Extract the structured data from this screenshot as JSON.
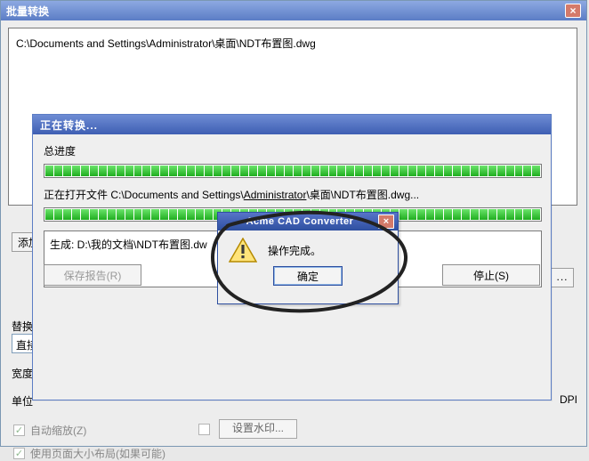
{
  "bg_window": {
    "title": "批量转换",
    "file_list_item": "C:\\Documents and Settings\\Administrator\\桌面\\NDT布置图.dwg",
    "add_file_button": "添加",
    "browse_button": "...",
    "replace_rule_label": "替换规",
    "direct_replace_option": "直接替",
    "width_label": "宽度",
    "unit_label": "单位",
    "dpi_label": "DPI",
    "auto_scale_checkbox": "自动缩放(Z)",
    "set_watermark_button": "设置水印...",
    "use_page_layout_checkbox": "使用页面大小布局(如果可能)"
  },
  "progress_dialog": {
    "title": "正在转换...",
    "overall_label": "总进度",
    "status_line_prefix": "正在打开文件 C:\\Documents and Settings\\",
    "status_line_underlined": "Administrator",
    "status_line_suffix": "\\桌面\\NDT布置图.dwg...",
    "generated_line": "生成: D:\\我的文档\\NDT布置图.dw",
    "save_report_button": "保存报告(R)",
    "stop_button": "停止(S)"
  },
  "alert": {
    "title": "Acme CAD Converter",
    "message": "操作完成。",
    "ok_button": "确定"
  },
  "icons": {
    "close_x": "×",
    "check_mark": "✓"
  }
}
